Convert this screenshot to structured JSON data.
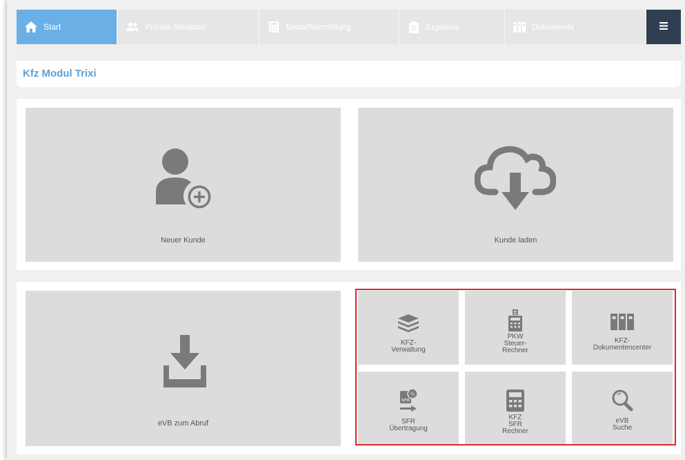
{
  "nav": {
    "tabs": [
      {
        "label": "Start",
        "icon": "home-icon",
        "active": true
      },
      {
        "label": "Private Situation",
        "icon": "users-icon",
        "active": false
      },
      {
        "label": "Bedarfsermittlung",
        "icon": "calculator-icon",
        "active": false
      },
      {
        "label": "Ergebnis",
        "icon": "clipboard-icon",
        "active": false
      },
      {
        "label": "Dokumente",
        "icon": "documents-icon",
        "active": false
      }
    ],
    "menu_icon": "hamburger-icon"
  },
  "page": {
    "title": "Kfz Modul Trixi"
  },
  "cards": {
    "new_customer": {
      "label": "Neuer Kunde",
      "icon": "add-user-icon"
    },
    "load_customer": {
      "label": "Kunde laden",
      "icon": "cloud-download-icon"
    },
    "evb": {
      "label": "eVB zum Abruf",
      "icon": "download-tray-icon"
    }
  },
  "tools": [
    {
      "lines": [
        "KFZ-",
        "Verwaltung"
      ],
      "icon": "layers-icon"
    },
    {
      "lines": [
        "PKW",
        "Steuer-",
        "Rechner"
      ],
      "icon": "tax-calculator-icon"
    },
    {
      "lines": [
        "KFZ-",
        "Dokumentencenter"
      ],
      "icon": "binders-icon"
    },
    {
      "lines": [
        "SFR",
        "Übertragung"
      ],
      "icon": "sfr-transfer-icon"
    },
    {
      "lines": [
        "KFZ",
        "SFR",
        "Rechner"
      ],
      "icon": "calculator-icon"
    },
    {
      "lines": [
        "eVB",
        "Suche"
      ],
      "icon": "magnifier-icon"
    }
  ],
  "colors": {
    "accent": "#6ab0e6",
    "title": "#5a9fd4",
    "menu": "#2f3e50",
    "highlight": "#d8262c",
    "tile": "#dcdcdc",
    "icon": "#7a7a7a"
  }
}
